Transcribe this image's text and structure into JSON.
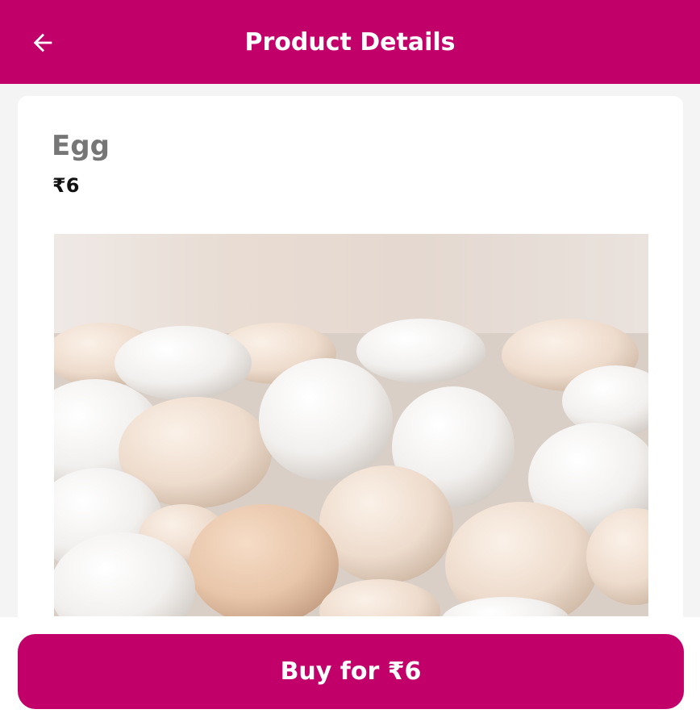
{
  "header": {
    "title": "Product Details",
    "back_icon": "arrow-left-icon"
  },
  "product": {
    "name": "Egg",
    "price": "₹6",
    "image": "eggs-photo"
  },
  "buy_button": {
    "label": "Buy for ₹6"
  },
  "colors": {
    "brand": "#c2006a",
    "background": "#f4f4f4",
    "card": "#ffffff"
  }
}
